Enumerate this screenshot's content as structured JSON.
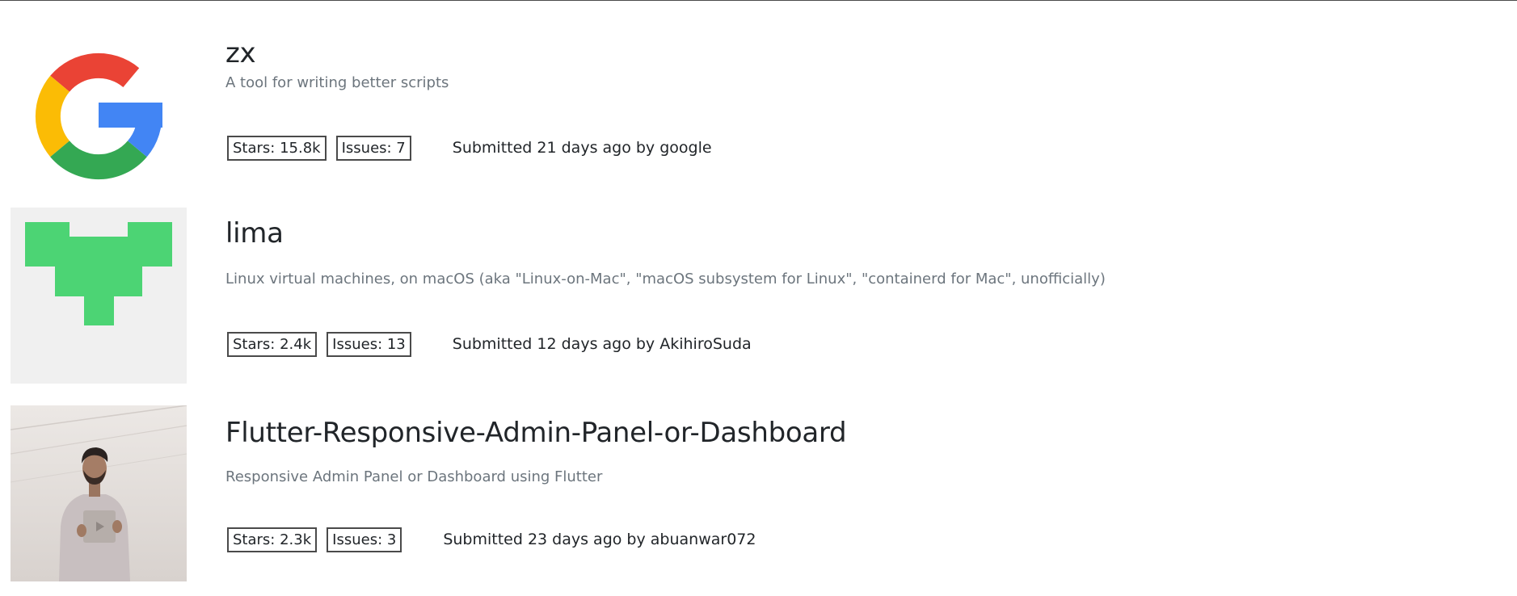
{
  "repos": [
    {
      "name": "zx",
      "description": "A tool for writing better scripts",
      "stars": "Stars: 15.8k",
      "issues": "Issues: 7",
      "submitted": "Submitted 21 days ago by google",
      "avatar": "google-logo-icon"
    },
    {
      "name": "lima",
      "description": "Linux virtual machines, on macOS (aka \"Linux-on-Mac\", \"macOS subsystem for Linux\", \"containerd for Mac\", unofficially)",
      "stars": "Stars: 2.4k",
      "issues": "Issues: 13",
      "submitted": "Submitted 12 days ago by AkihiroSuda",
      "avatar": "green-identicon-icon"
    },
    {
      "name": "Flutter-Responsive-Admin-Panel-or-Dashboard",
      "description": "Responsive Admin Panel or Dashboard using Flutter",
      "stars": "Stars: 2.3k",
      "issues": "Issues: 3",
      "submitted": "Submitted 23 days ago by abuanwar072",
      "avatar": "user-photo"
    }
  ],
  "colors": {
    "google_red": "#EA4335",
    "google_yellow": "#FBBC05",
    "google_green": "#34A853",
    "google_blue": "#4285F4",
    "identicon_green": "#4CD474",
    "identicon_bg": "#F0F0F0",
    "muted_text": "#6c757d"
  }
}
